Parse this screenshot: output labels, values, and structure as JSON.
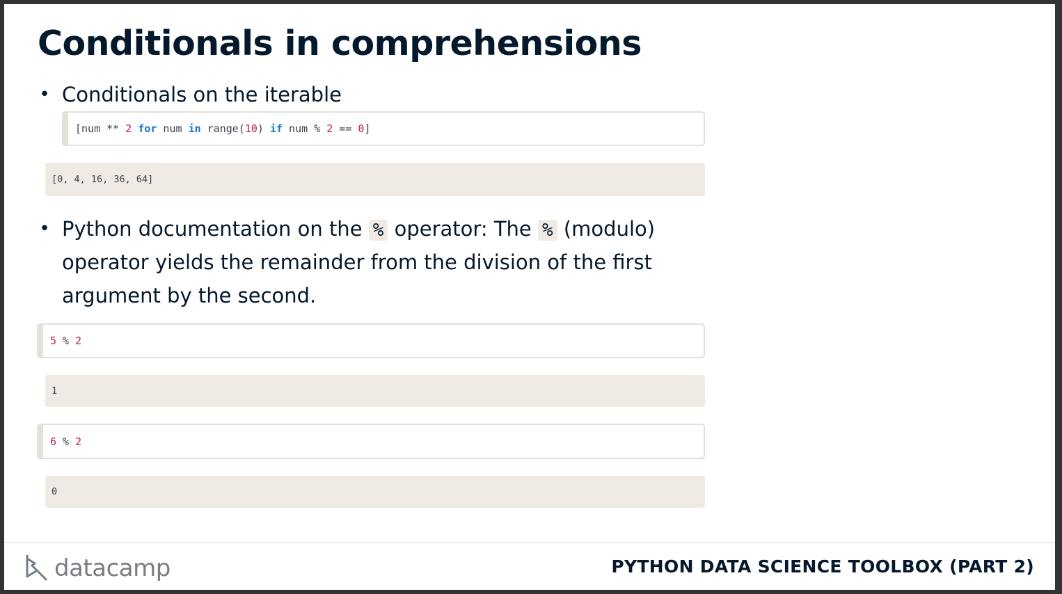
{
  "slide": {
    "title": "Conditionals in comprehensions",
    "bullet1": {
      "marker": "•",
      "text": "Conditionals on the iterable"
    },
    "code1": {
      "t1": "[num ** ",
      "n1": "2",
      "t2": " ",
      "k1": "for",
      "t3": " num ",
      "k2": "in",
      "t4": " range(",
      "n2": "10",
      "t5": ") ",
      "k3": "if",
      "t6": " num % ",
      "n3": "2",
      "t7": " == ",
      "n4": "0",
      "t8": "]"
    },
    "output1": "[0, 4, 16, 36, 64]",
    "bullet2": {
      "marker": "•",
      "line1_a": "Python documentation on the ",
      "code_a": "%",
      "line1_b": " operator: The ",
      "code_b": "%",
      "line1_c": " (modulo)",
      "line2": "operator yields the remainder from the division of the first",
      "line3": "argument by the second."
    },
    "code2": {
      "n1": "5",
      "op": " % ",
      "n2": "2"
    },
    "output2": "1",
    "code3": {
      "n1": "6",
      "op": " % ",
      "n2": "2"
    },
    "output3": "0"
  },
  "footer": {
    "logo_text": "datacamp",
    "course": "PYTHON DATA SCIENCE TOOLBOX (PART 2)"
  },
  "colors": {
    "text": "#05192d",
    "code_bg": "#efebe4",
    "keyword": "#1a73c9",
    "number": "#c2185b"
  }
}
